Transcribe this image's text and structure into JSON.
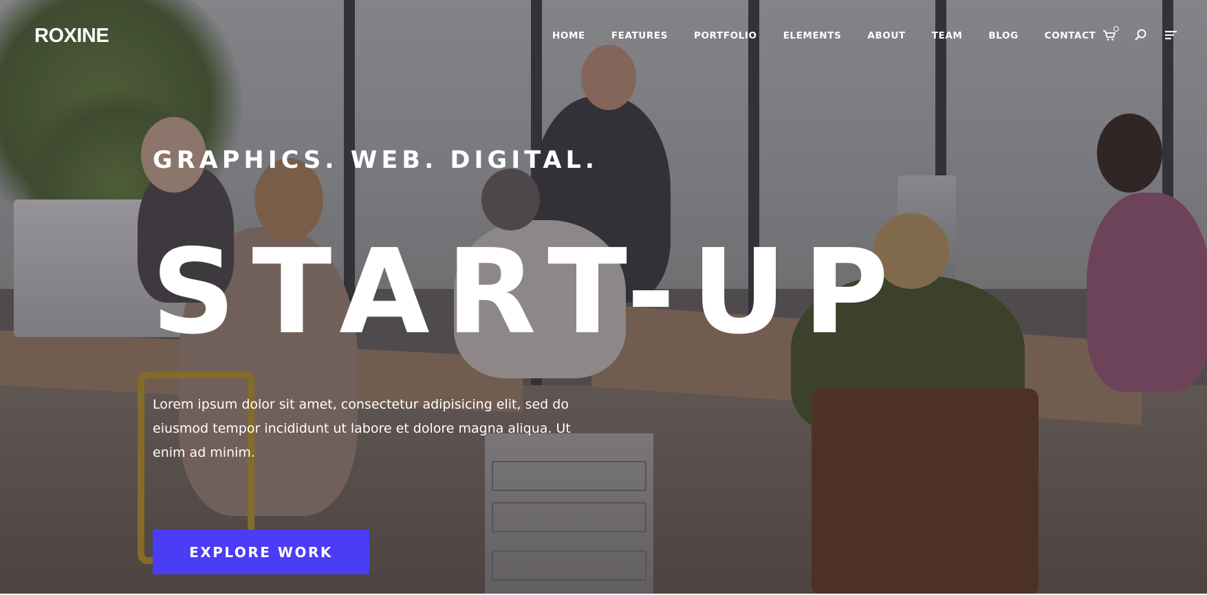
{
  "brand": {
    "logo_text": "ROXINE"
  },
  "nav": {
    "items": [
      {
        "label": "HOME"
      },
      {
        "label": "FEATURES"
      },
      {
        "label": "PORTFOLIO"
      },
      {
        "label": "ELEMENTS"
      },
      {
        "label": "ABOUT"
      },
      {
        "label": "TEAM"
      },
      {
        "label": "BLOG"
      },
      {
        "label": "CONTACT"
      }
    ],
    "icons": [
      "cart-icon",
      "search-icon",
      "menu-icon"
    ]
  },
  "hero": {
    "tagline": "GRAPHICS. WEB. DIGITAL.",
    "headline": "START-UP",
    "intro": "Lorem ipsum dolor sit amet, consectetur adipisicing elit, sed do eiusmod tempor incididunt ut labore et dolore magna aliqua. Ut enim ad minim.",
    "cta_label": "EXPLORE WORK",
    "background": "office team working photo"
  },
  "colors": {
    "accent": "#4b3cf5",
    "text": "#ffffff",
    "overlay": "rgba(35,30,40,0.42)"
  }
}
